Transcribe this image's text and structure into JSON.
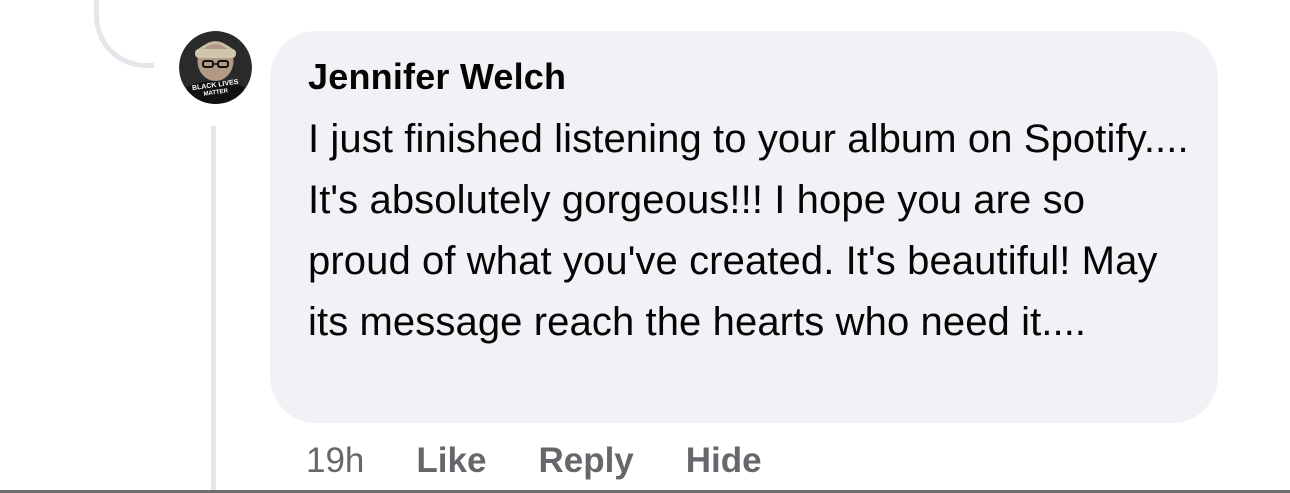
{
  "comment": {
    "author": "Jennifer Welch",
    "text": "I just finished listening to your album on Spotify.... It's absolutely gorgeous!!! I hope you are so proud of what you've created. It's beautiful! May its message reach the hearts who need it....",
    "avatar_text": [
      "BLACK LIVES",
      "MATTER"
    ],
    "timestamp": "19h",
    "actions": {
      "like_label": "Like",
      "reply_label": "Reply",
      "hide_label": "Hide"
    }
  },
  "colors": {
    "bubble_background": "#f0f2f5",
    "thread_line": "#e4e6eb",
    "secondary_text": "#65676b",
    "primary_text": "#050505"
  },
  "icons": {
    "avatar": "profile-photo"
  }
}
